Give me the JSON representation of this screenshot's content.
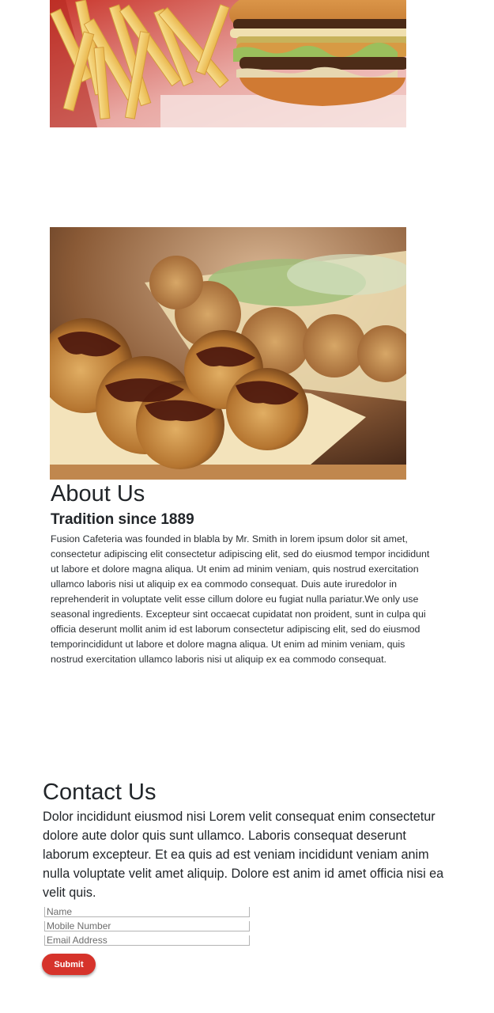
{
  "about": {
    "title": "About Us",
    "subtitle": "Tradition since 1889",
    "body": "Fusion Cafeteria was founded in blabla by Mr. Smith in lorem ipsum dolor sit amet, consectetur adipiscing elit consectetur adipiscing elit, sed do eiusmod tempor incididunt ut labore et dolore magna aliqua. Ut enim ad minim veniam, quis nostrud exercitation ullamco laboris nisi ut aliquip ex ea commodo consequat. Duis aute iruredolor in reprehenderit in voluptate velit esse cillum dolore eu fugiat nulla pariatur.We only use seasonal ingredients. Excepteur sint occaecat cupidatat non proident, sunt in culpa qui officia deserunt mollit anim id est laborum consectetur adipiscing elit, sed do eiusmod temporincididunt ut labore et dolore magna aliqua. Ut enim ad minim veniam, quis nostrud exercitation ullamco laboris nisi ut aliquip ex ea commodo consequat."
  },
  "contact": {
    "title": "Contact Us",
    "body": "Dolor incididunt eiusmod nisi Lorem velit consequat enim consectetur dolore aute dolor quis sunt ullamco. Laboris consequat deserunt laborum excepteur. Et ea quis ad est veniam incididunt veniam anim nulla voluptate velit amet aliquip. Dolore est anim id amet officia nisi ea velit quis.",
    "form": {
      "name_placeholder": "Name",
      "mobile_placeholder": "Mobile Number",
      "email_placeholder": "Email Address",
      "submit_label": "Submit"
    }
  },
  "colors": {
    "accent": "#d6332b",
    "text": "#212529"
  },
  "icons": {
    "burger_photo": "burger-fries-photo",
    "takoyaki_photo": "takoyaki-photo"
  }
}
